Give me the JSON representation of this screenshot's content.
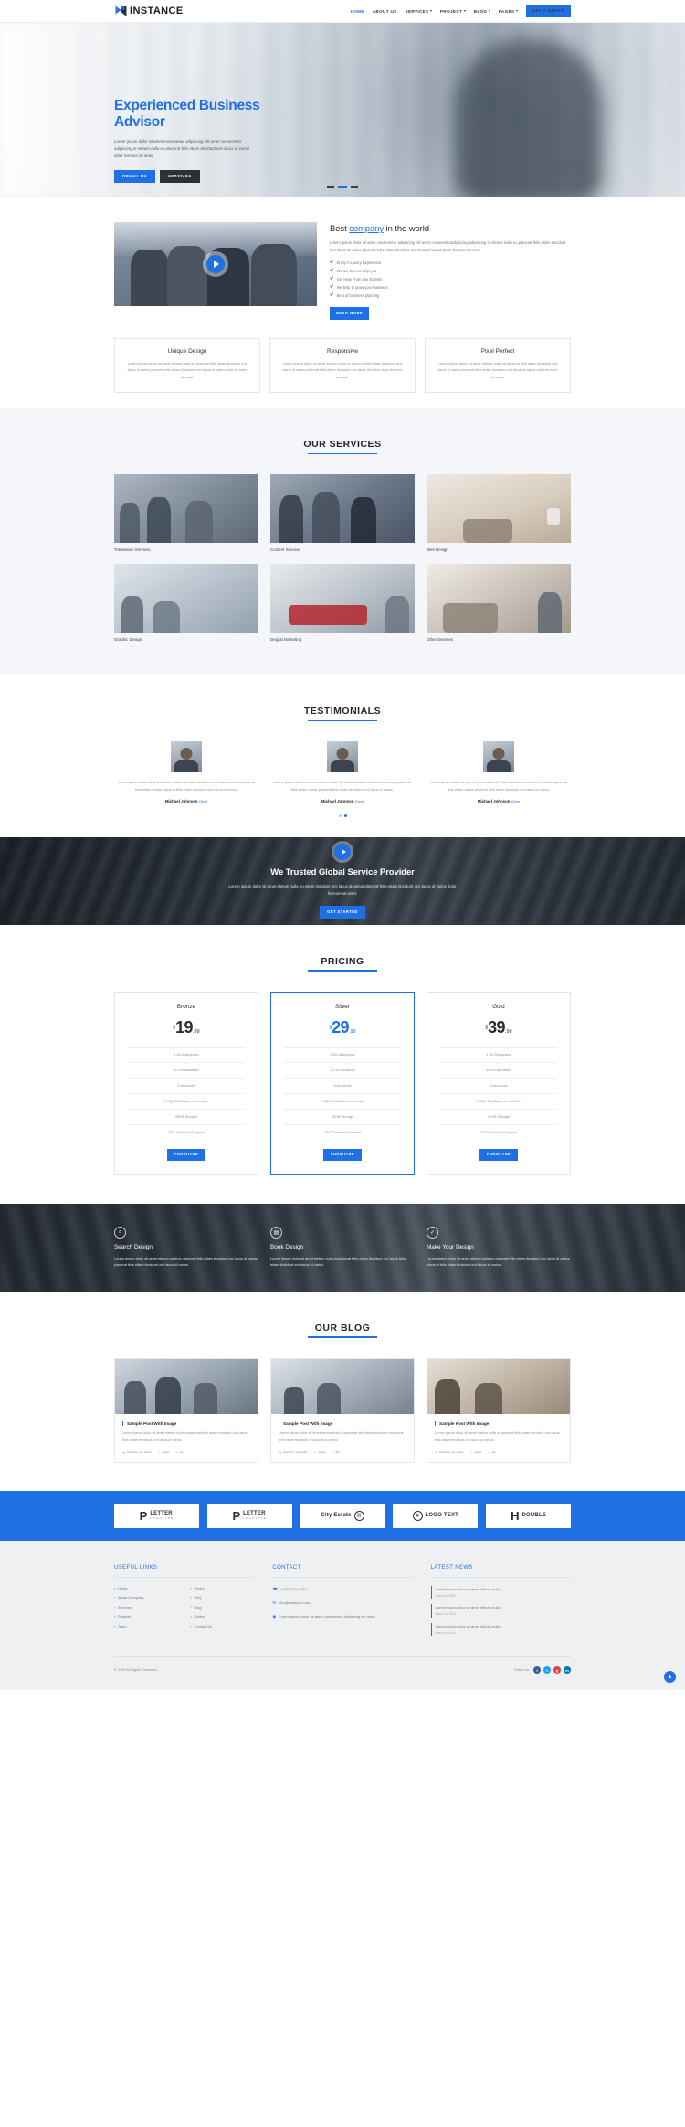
{
  "header": {
    "logo_text": "INSTANCE",
    "nav": [
      {
        "label": "HOME",
        "active": true,
        "caret": false
      },
      {
        "label": "ABOUT US",
        "active": false,
        "caret": false
      },
      {
        "label": "SERVICES",
        "active": false,
        "caret": true
      },
      {
        "label": "PROJECT",
        "active": false,
        "caret": true
      },
      {
        "label": "BLOG",
        "active": false,
        "caret": true
      },
      {
        "label": "PAGES",
        "active": false,
        "caret": true
      }
    ],
    "quote_button": "GET A QUOTE"
  },
  "hero": {
    "title": "Experienced Business Advisor",
    "paragraph": "Lorem ipsum dolor sit amet consectetur adipiscing elit amet consectetur adipiscing et eletum nulla eu placerat felis etiam tincidunt orci lacus id varius dolor fermum sit amet.",
    "btn_primary": "ABOUT US",
    "btn_secondary": "SERVICES",
    "dots": 3,
    "active_dot": 1
  },
  "about": {
    "heading_pre": "Best ",
    "heading_link": "company",
    "heading_post": " in the world",
    "lead": "Lorem ipsum dolor sit amet consectetur adipiscing elit amet consecteturadipiscing adipiscing et eletum nulla eu placerat felis etiam tincidunt orci lacus id varius placerat felis etiam tincidunt orci lacus id varius dolor fermum sit amet.",
    "checks": [
      "Enjoy A Luxury Experience",
      "We are here to help you",
      "Get Help From Our Experts",
      "We help to grow your business",
      "Best of business planning"
    ],
    "read_more": "READ MORE",
    "play_icon": "play-icon"
  },
  "features": [
    {
      "title": "Unique Design",
      "text": "Lorem ipsum dolor sit amet eletum nulla eu placerat felis etiam tincidunt orci lacus id varius placerat felis etiam tincidunt orci lacus id varius dolor fermum sit amet."
    },
    {
      "title": "Responsive",
      "text": "Lorem ipsum dolor sit amet eletum nulla eu placerat felis etiam tincidunt orci lacus id varius placerat felis etiam tincidunt orci lacus id varius dolor fermum sit amet."
    },
    {
      "title": "Pixel Perfect",
      "text": "Lorem ipsum dolor sit amet eletum nulla eu placerat felis etiam tincidunt orci lacus id varius placerat felis etiam tincidunt orci lacus id varius dolor fermum sit amet."
    }
  ],
  "services": {
    "title": "OUR SERVICES",
    "items": [
      {
        "caption": "Translation Services"
      },
      {
        "caption": "Content Services"
      },
      {
        "caption": "Web Design"
      },
      {
        "caption": "Graphic Design"
      },
      {
        "caption": "Degital Marketing"
      },
      {
        "caption": "Other Services"
      }
    ]
  },
  "testimonials": {
    "title": "TESTIMONIALS",
    "items": [
      {
        "text": "Lorem ipsum dolor sit amet eletum nulla elis etiam tincidunt orci lacus id varius placerat felis etiam varius placerat felis etiam tincidunt orci lacus id varius.",
        "name": "Michael Johnson",
        "role": "Client"
      },
      {
        "text": "Lorem ipsum dolor sit amet eletum nulla elis etiam tincidunt orci lacus id varius placerat felis etiam varius placerat felis etiam tincidunt orci lacus id varius.",
        "name": "Michael Johnson",
        "role": "Client"
      },
      {
        "text": "Lorem ipsum dolor sit amet eletum nulla elis etiam tincidunt orci lacus id varius placerat felis etiam varius placerat felis etiam tincidunt orci lacus id varius.",
        "name": "Michael Johnson",
        "role": "Client"
      }
    ],
    "dots": 2,
    "active_dot": 2
  },
  "cta": {
    "title": "We Trusted Global Service Provider",
    "text": "Lorem ipsum dolor sit amet eletum nulla eu etiam tincidunt orci lacus id varius placerat felis etiam tincidunt orci lacus id varius dolor fermum sit amet.",
    "button": "GET STARTED",
    "play_icon": "play-icon"
  },
  "pricing": {
    "title": "PRICING",
    "plans": [
      {
        "name": "Bronze",
        "currency": "$",
        "amount": "19",
        "cents": ".99",
        "highlight": false,
        "features": [
          "1 Gb Diskspace",
          "10 Gb Bandwith",
          "5 Accounts",
          "1 SQL Database for website",
          "25GB Storage",
          "24/7 Technical Support"
        ],
        "button": "PURCHASE"
      },
      {
        "name": "Silver",
        "currency": "$",
        "amount": "29",
        "cents": ".99",
        "highlight": true,
        "features": [
          "1 Gb Diskspace",
          "10 Gb Bandwith",
          "5 Accounts",
          "1 SQL Database for website",
          "25GB Storage",
          "24/7 Technical Support"
        ],
        "button": "PURCHASE"
      },
      {
        "name": "Gold",
        "currency": "$",
        "amount": "39",
        "cents": ".99",
        "highlight": false,
        "features": [
          "1 Gb Diskspace",
          "10 Gb Bandwith",
          "5 Accounts",
          "1 SQL Database for website",
          "25GB Storage",
          "24/7 Technical Support"
        ],
        "button": "PURCHASE"
      }
    ]
  },
  "strip": [
    {
      "icon": "search-icon",
      "glyph": "⌕",
      "title": "Search Design",
      "text": "Lorem ipsum dolor sit amet eletum nulla eu placerat felis etiam tincidunt orci lacus id varius placerat felis etiam tincidunt orci lacus id varius."
    },
    {
      "icon": "book-icon",
      "glyph": "▤",
      "title": "Book Design",
      "text": "Lorem ipsum dolor sit amet eletum nulla euplacerat felis etiam tincidunt orci lacus felis etiam tincidunt orci lacus id varius."
    },
    {
      "icon": "check-icon",
      "glyph": "✓",
      "title": "Make Your Design",
      "text": "Lorem ipsum dolor sit amet eletum nulla eu placerat felis etiam tincidunt orci lacus id varius placerat felis etiam tincidunt orci lacus id varius."
    }
  ],
  "blog": {
    "title": "OUR BLOG",
    "posts": [
      {
        "title": "Sample Post With Image",
        "excerpt": "Lorem ipsum dolor sit amet eletum nulla euplacerat felis etiam tincidunt orci lacus felis etiam tincidunt orci lacus id varius.",
        "date": "MARCH 10, 2020",
        "admin": "ADM",
        "comments": "23"
      },
      {
        "title": "Sample Post With Image",
        "excerpt": "Lorem ipsum dolor sit amet eletum nulla euplacerat felis etiam tincidunt orci lacus felis etiam tincidunt orci lacus id varius.",
        "date": "MARCH 10, 2020",
        "admin": "ADM",
        "comments": "23"
      },
      {
        "title": "Sample Post With Image",
        "excerpt": "Lorem ipsum dolor sit amet eletum nulla euplacerat felis etiam tincidunt orci lacus felis etiam tincidunt orci lacus id varius.",
        "date": "MARCH 10, 2020",
        "admin": "ADM",
        "comments": "23"
      }
    ]
  },
  "clients": [
    {
      "big": "P",
      "name": "LETTER",
      "sub": "LOGOTYPE"
    },
    {
      "big": "P",
      "name": "LETTER",
      "sub": "LOGOTYPE"
    },
    {
      "big": "",
      "name": "City Estate",
      "sub": ""
    },
    {
      "big": "",
      "name": "LOGO TEXT",
      "sub": ""
    },
    {
      "big": "",
      "name": "DOUBLE",
      "sub": ""
    }
  ],
  "footer": {
    "useful_links": {
      "title_first": "U",
      "title_rest": "SEFUL LINKS",
      "col1": [
        "Home",
        "About Company",
        "Services",
        "Projects",
        "Team"
      ],
      "col2": [
        "Pricing",
        "FAQ",
        "Blog",
        "Gallery",
        "Contact Us"
      ]
    },
    "contact": {
      "title_first": "C",
      "title_rest": "ONTACT",
      "items": [
        {
          "icon": "phone-icon",
          "glyph": "☎",
          "text": "+100 1234 4567"
        },
        {
          "icon": "mail-icon",
          "glyph": "✉",
          "text": "info@example.com"
        },
        {
          "icon": "location-icon",
          "glyph": "◉",
          "text": "Lorem ipsum dolor sit amet consectetur adipiscing elit amet."
        }
      ]
    },
    "latest_news": {
      "title_first": "L",
      "title_rest": "ATEST NEWS",
      "items": [
        {
          "text": "Lorem ipsum dolor sit amet eletum nulla",
          "date": "March 10, 2020"
        },
        {
          "text": "Lorem ipsum dolor sit amet eletum nulla",
          "date": "March 10, 2020"
        },
        {
          "text": "Lorem ipsum dolor sit amet eletum nulla",
          "date": "March 10, 2020"
        }
      ]
    },
    "copyright": "© 2020 All Rights Reserved",
    "follow_label": "Follow us",
    "social": [
      {
        "name": "facebook-icon",
        "glyph": "f",
        "cls": "fb"
      },
      {
        "name": "twitter-icon",
        "glyph": "t",
        "cls": "tw"
      },
      {
        "name": "google-plus-icon",
        "glyph": "g",
        "cls": "gp"
      },
      {
        "name": "linkedin-icon",
        "glyph": "in",
        "cls": "in"
      }
    ],
    "to_top_icon": "chevron-up-icon"
  },
  "colors": {
    "accent": "#1f6fe5",
    "dark": "#2b3136",
    "light_bg": "#f4f6fa",
    "footer_bg": "#eef0f2"
  }
}
